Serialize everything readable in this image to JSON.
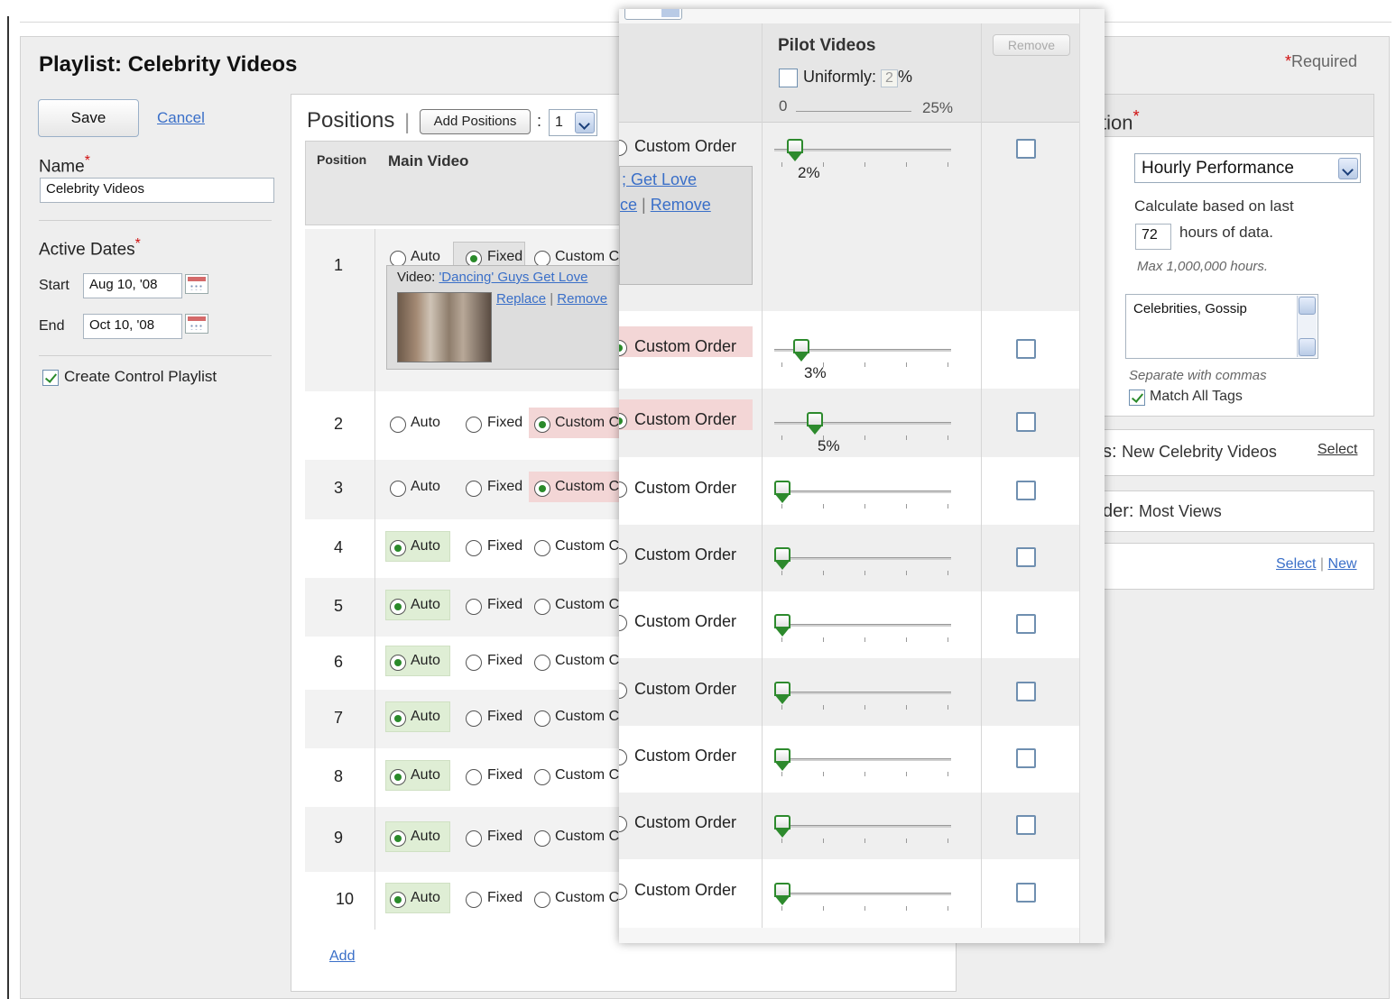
{
  "title": "Playlist: Celebrity Videos",
  "required_label": "Required",
  "required_star": "*",
  "actions": {
    "save": "Save",
    "cancel": "Cancel"
  },
  "name_field": {
    "label": "Name",
    "value": "Celebrity Videos"
  },
  "active_dates": {
    "label": "Active Dates",
    "start_label": "Start",
    "start_value": "Aug 10, '08",
    "end_label": "End",
    "end_value": "Oct 10, '08"
  },
  "control_playlist": {
    "label": "Create Control Playlist",
    "checked": true
  },
  "positions": {
    "title": "Positions",
    "separator": "|",
    "add_button": "Add Positions",
    "colon": ":",
    "count_select": "1",
    "col_position": "Position",
    "col_main_video": "Main Video",
    "option_auto": "Auto",
    "option_fixed": "Fixed",
    "option_custom": "Custom C",
    "rows": [
      {
        "num": "1",
        "selected": "fixed"
      },
      {
        "num": "2",
        "selected": "custom"
      },
      {
        "num": "3",
        "selected": "custom"
      },
      {
        "num": "4",
        "selected": "auto"
      },
      {
        "num": "5",
        "selected": "auto"
      },
      {
        "num": "6",
        "selected": "auto"
      },
      {
        "num": "7",
        "selected": "auto"
      },
      {
        "num": "8",
        "selected": "auto"
      },
      {
        "num": "9",
        "selected": "auto"
      },
      {
        "num": "10",
        "selected": "auto"
      }
    ],
    "video": {
      "prefix": "Video:",
      "title": "'Dancing' Guys Get Love",
      "replace": "Replace",
      "pipe": "|",
      "remove": "Remove"
    },
    "add_link": "Add"
  },
  "ranking": {
    "header_partial": "tion",
    "metric_select": "Hourly Performance",
    "calc_label": "Calculate based on last",
    "hours_value": "72",
    "hours_label": "hours of data.",
    "max_note": "Max 1,000,000 hours.",
    "tags_value": "Celebrities, Gossip",
    "tags_note": "Separate with commas",
    "match_all": "Match All Tags",
    "match_all_checked": true,
    "source_prefix": "s:",
    "source_value": "New Celebrity Videos",
    "source_select": "Select",
    "order_prefix": "der:",
    "order_value": "Most Views",
    "select_link": "Select",
    "pipe": "|",
    "new_link": "New"
  },
  "pilot": {
    "title": "Pilot Videos",
    "uniformly_label": "Uniformly:",
    "uniformly_value": "2",
    "percent": "%",
    "range_min": "0",
    "range_max": "25%",
    "remove_button": "Remove",
    "custom_order": "Custom Order",
    "video_partial": "; Get Love",
    "replace_partial": "ce",
    "pipe": "|",
    "remove_link": "Remove",
    "rows": [
      {
        "pct_value": 2,
        "pct_label": "2%",
        "highlight": false
      },
      {
        "pct_value": 3,
        "pct_label": "3%",
        "highlight": true
      },
      {
        "pct_value": 5,
        "pct_label": "5%",
        "highlight": true
      },
      {
        "pct_value": 0,
        "pct_label": "",
        "highlight": false
      },
      {
        "pct_value": 0,
        "pct_label": "",
        "highlight": false
      },
      {
        "pct_value": 0,
        "pct_label": "",
        "highlight": false
      },
      {
        "pct_value": 0,
        "pct_label": "",
        "highlight": false
      },
      {
        "pct_value": 0,
        "pct_label": "",
        "highlight": false
      },
      {
        "pct_value": 0,
        "pct_label": "",
        "highlight": false
      },
      {
        "pct_value": 0,
        "pct_label": "",
        "highlight": false
      }
    ],
    "slider_max": 25
  },
  "colors": {
    "accent_green": "#2a8a2a",
    "link": "#3a6fc8",
    "required_red": "#d01010",
    "highlight_red": "#f3d6d6",
    "highlight_green": "#dfeed5"
  }
}
